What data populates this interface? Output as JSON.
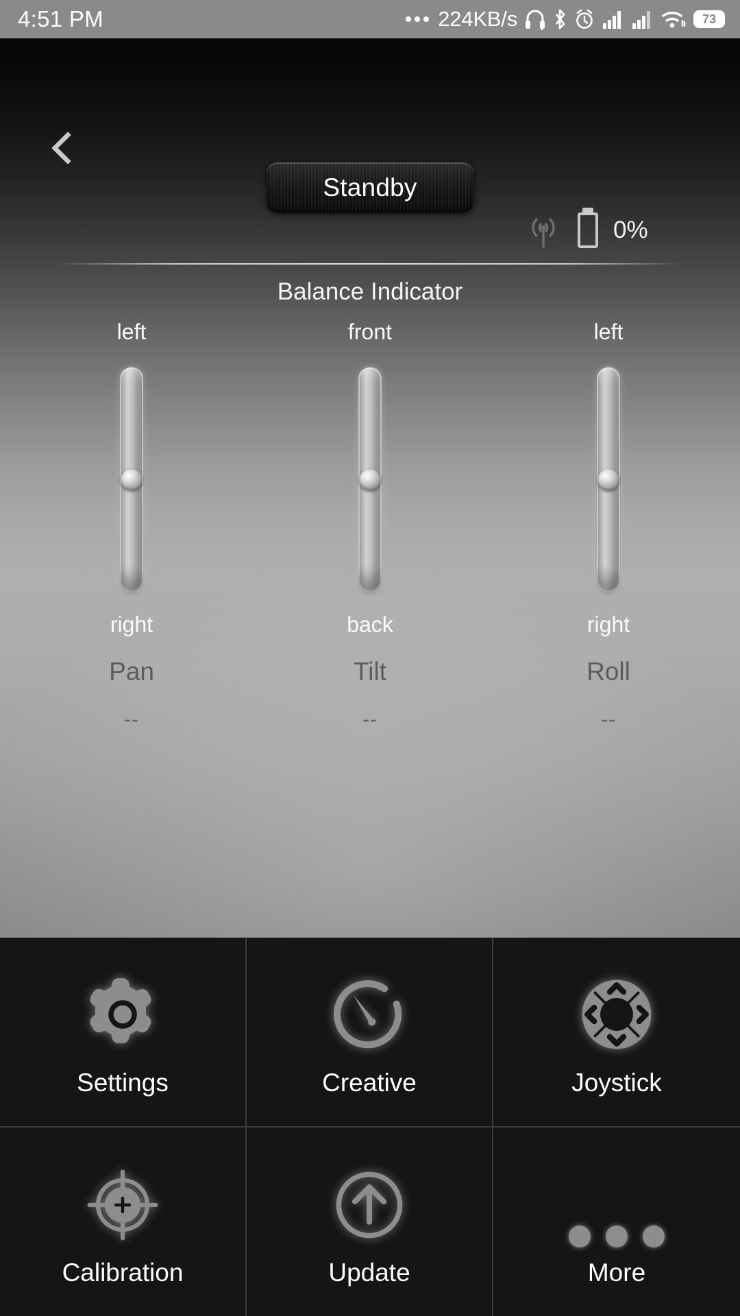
{
  "statusbar": {
    "time": "4:51 PM",
    "network_speed": "224KB/s",
    "overflow_icon": "more-dots-icon",
    "headset_icon": "headset-icon",
    "bluetooth_icon": "bluetooth-icon",
    "alarm_icon": "alarm-clock-icon",
    "signal1_icon": "signal-bars-icon",
    "signal2_icon": "signal-bars-icon",
    "wifi_icon": "wifi-icon",
    "battery_level": "73",
    "bar_color": "#8a8a8a"
  },
  "header": {
    "back_icon": "chevron-left-icon",
    "status_label": "Standby",
    "rf_icon": "rf-signal-icon",
    "battery_icon": "battery-icon",
    "battery_percent": "0%"
  },
  "balance": {
    "title": "Balance Indicator",
    "axes": [
      {
        "top_label": "left",
        "bottom_label": "right",
        "name": "Pan",
        "value": "--",
        "knob_position_pct": 50
      },
      {
        "top_label": "front",
        "bottom_label": "back",
        "name": "Tilt",
        "value": "--",
        "knob_position_pct": 50
      },
      {
        "top_label": "left",
        "bottom_label": "right",
        "name": "Roll",
        "value": "--",
        "knob_position_pct": 50
      }
    ]
  },
  "menu": {
    "items": [
      {
        "label": "Settings",
        "icon": "gear-icon"
      },
      {
        "label": "Creative",
        "icon": "gauge-icon"
      },
      {
        "label": "Joystick",
        "icon": "dpad-icon"
      },
      {
        "label": "Calibration",
        "icon": "crosshair-target-icon"
      },
      {
        "label": "Update",
        "icon": "arrow-up-circle-icon"
      },
      {
        "label": "More",
        "icon": "three-dots-icon"
      }
    ]
  },
  "colors": {
    "status_bar": "#8a8a8a",
    "panel_dark": "#060606",
    "panel_light": "#afafaf",
    "grid_bg": "#151515",
    "icon_gray": "#8d8d8d",
    "axis_label": "#5c5c5c"
  }
}
